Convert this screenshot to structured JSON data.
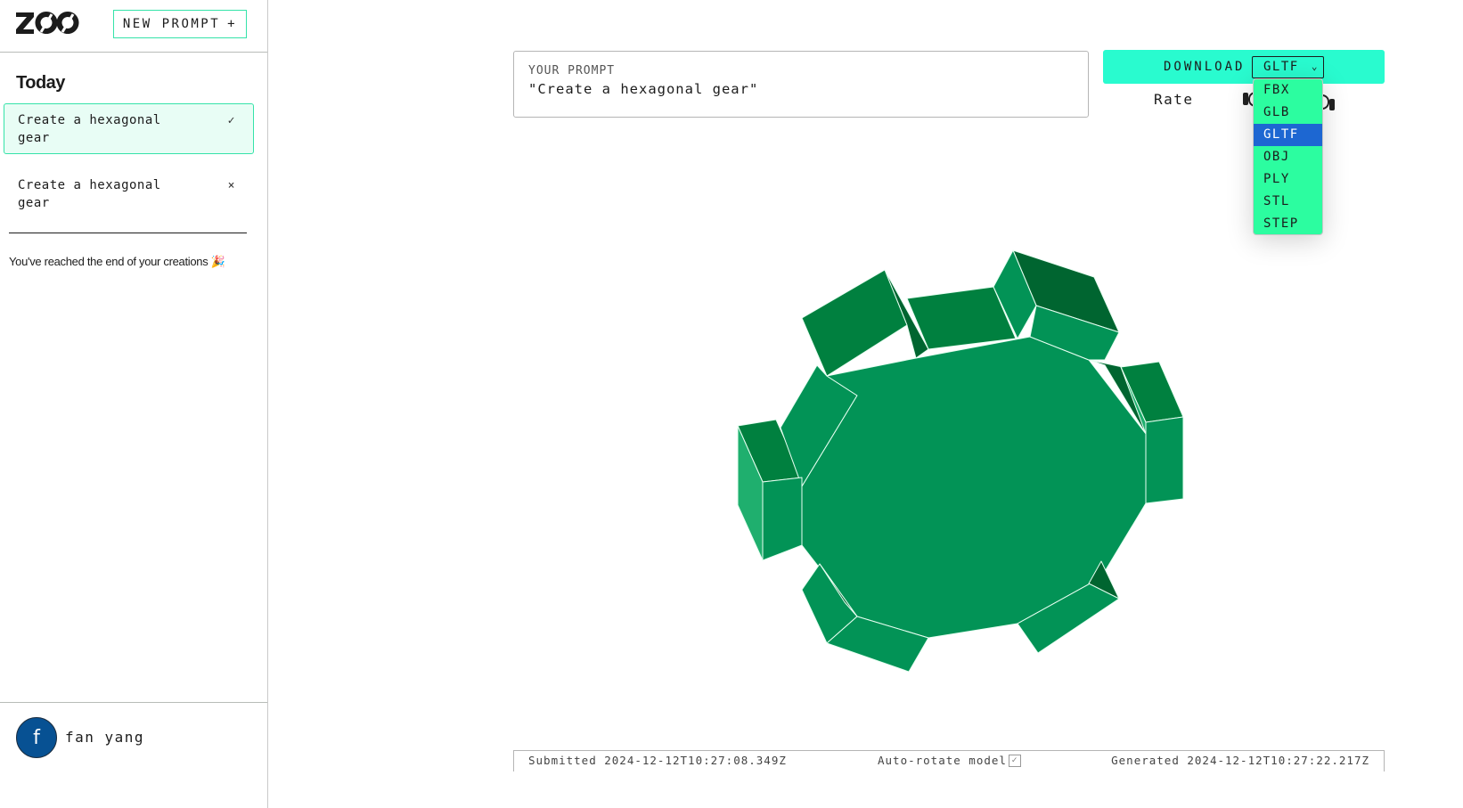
{
  "app": {
    "logo_text": "ZOO"
  },
  "sidebar": {
    "new_prompt_label": "NEW PROMPT",
    "new_prompt_icon": "plus-icon",
    "section_title": "Today",
    "items": [
      {
        "label": "Create a hexagonal gear",
        "status": "✓",
        "status_icon": "check-icon",
        "active": true
      },
      {
        "label": "Create a hexagonal gear",
        "status": "×",
        "status_icon": "close-icon",
        "active": false
      }
    ],
    "end_note": "You've reached the end of your creations 🎉",
    "user": {
      "avatar_initial": "f",
      "name": "fan yang"
    }
  },
  "prompt": {
    "label": "YOUR PROMPT",
    "text": "\"Create a hexagonal gear\""
  },
  "download": {
    "label": "DOWNLOAD",
    "selected_format": "GLTF",
    "options": [
      "FBX",
      "GLB",
      "GLTF",
      "OBJ",
      "PLY",
      "STL",
      "STEP"
    ]
  },
  "rating": {
    "label": "Rate"
  },
  "footer": {
    "submitted": "Submitted 2024-12-12T10:27:08.349Z",
    "autorotate_label": "Auto-rotate model",
    "autorotate_checked": true,
    "autorotate_mark": "✓",
    "generated": "Generated 2024-12-12T10:27:22.217Z"
  },
  "colors": {
    "accent": "#29fbcf",
    "accent_border": "#35e3a9",
    "dropdown_bg": "#2cfda0",
    "selected_option": "#1d67d2",
    "avatar": "#075193",
    "gear_face": "#029356",
    "gear_side_dark": "#006530",
    "gear_side_mid": "#00803f",
    "gear_side_light": "#1faf6e"
  }
}
